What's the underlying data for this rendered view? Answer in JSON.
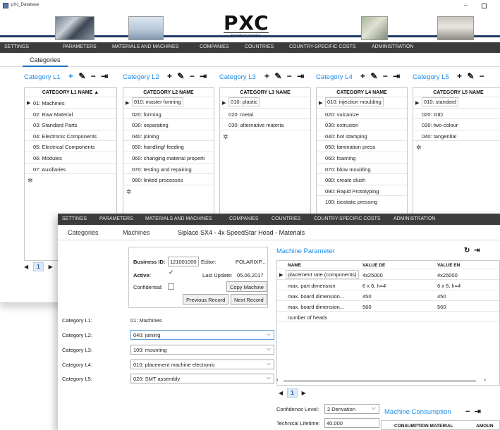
{
  "window": {
    "title": "pXc_Database",
    "logo_big": "PXC",
    "logo_small": "POLARIXCOSTING"
  },
  "menu": [
    "SETTINGS",
    "PARAMETERS",
    "MATERIALS AND MACHINES",
    "COMPANIES",
    "COUNTRIES",
    "COUNTRY-SPECIFIC COSTS",
    "ADMINISTRATION"
  ],
  "back_tab": "Categories",
  "categories": [
    {
      "title": "Category L1",
      "column": "CATEGORY L1 NAME",
      "sort_indicator": "▲",
      "rows": [
        "01: Machines",
        "02: Raw Material",
        "03: Standard Parts",
        "04: Electronic Components",
        "05: Electrical Components",
        "06: Modules",
        "07: Auxillaries"
      ]
    },
    {
      "title": "Category L2",
      "column": "CATEGORY L2 NAME",
      "rows": [
        "010: master forming",
        "020: forming",
        "030: separating",
        "040: joining",
        "050: handling/ feeding",
        "060: changing material properti",
        "070: testing and repairing",
        "080: linked processes"
      ]
    },
    {
      "title": "Category L3",
      "column": "CATEGORY L3 NAME",
      "rows": [
        "010: plastic",
        "020: metal",
        "030: alternative materia"
      ]
    },
    {
      "title": "Category L4",
      "column": "CATEGORY L4 NAME",
      "rows": [
        "010: injection moulding",
        "020: vulcanize",
        "030: extrusion",
        "040: hot stamping",
        "050: lamination press",
        "060: foaming",
        "070: blow moulding",
        "080: create slush",
        "090: Rapid Prototyping",
        "100: isostatic pressing"
      ]
    },
    {
      "title": "Category L5",
      "column": "CATEGORY L5 NAME",
      "rows": [
        "010: standard",
        "020: GID",
        "030: two-colour",
        "040: tangential"
      ]
    }
  ],
  "back_pager": {
    "current": "1"
  },
  "front": {
    "tabs": [
      "Categories",
      "Machines",
      "Siplace SX4 - 4x SpeedStar Head - Materials"
    ],
    "business_id_label": "Business ID:",
    "business_id": "121001000",
    "editor_label": "Editor:",
    "editor": "POLARIXP...",
    "active_label": "Active:",
    "active_check": "✓",
    "last_update_label": "Last Update:",
    "last_update": "05.06.2017",
    "confidential_label": "Confidential:",
    "copy_button": "Copy Machine",
    "prev_button": "Previous Record",
    "next_button": "Next Record",
    "cat_labels": [
      "Category L1:",
      "Category L2:",
      "Category L3:",
      "Category L4:",
      "Category L5:"
    ],
    "cat_l1_value": "01: Machines",
    "cat_l2_value": "040: joining",
    "cat_l3_value": "100: mounting",
    "cat_l4_value": "010: placement machine electronic",
    "cat_l5_value": "020: SMT assembly",
    "machine_parameter_title": "Machine Parameter",
    "mp_columns": [
      "NAME",
      "VALUE DE",
      "VALUE EN"
    ],
    "mp_rows": [
      [
        "placement rate (components)",
        "4x25000",
        "4x25000"
      ],
      [
        "max. part dimension",
        "6 x 6, h=4",
        "6 x 6, h=4"
      ],
      [
        "max. board dimension...",
        "450",
        "450"
      ],
      [
        "max. board dimension...",
        "560",
        "560"
      ],
      [
        "number of heads",
        "",
        ""
      ]
    ],
    "pager_current": "1",
    "confidence_label": "Confidence Level:",
    "confidence_value": "2 Derivation",
    "lifetime_label": "Technical Lifetime:",
    "lifetime_value": "40.000",
    "consumption_title": "Machine Consumption",
    "consumption_columns": [
      "CONSUMPTION MATERIAL",
      "AMOUN"
    ]
  }
}
